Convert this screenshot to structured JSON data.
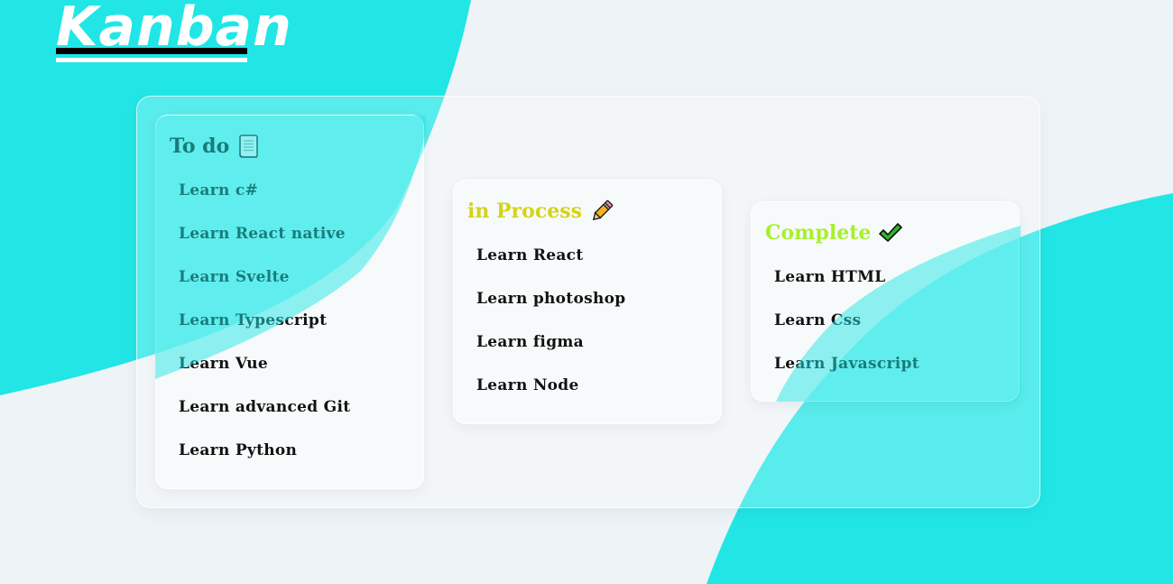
{
  "app": {
    "title": "Kanban"
  },
  "colors": {
    "background": "#eef3f7",
    "accent_cyan": "#22e6e6",
    "todo_title": "#111111",
    "process_title": "#d4d419",
    "complete_title": "#a8f02c"
  },
  "columns": {
    "todo": {
      "title": "To do",
      "icon": "scroll-icon",
      "items": [
        "Learn c#",
        "Learn React native",
        "Learn Svelte",
        "Learn Typescript",
        "Learn Vue",
        "Learn advanced Git",
        "Learn Python"
      ]
    },
    "process": {
      "title": "in Process",
      "icon": "pencil-icon",
      "items": [
        "Learn React",
        "Learn photoshop",
        "Learn figma",
        "Learn Node"
      ]
    },
    "complete": {
      "title": "Complete",
      "icon": "check-mark-icon",
      "items": [
        "Learn HTML",
        "Learn Css",
        "Learn Javascript"
      ]
    }
  }
}
